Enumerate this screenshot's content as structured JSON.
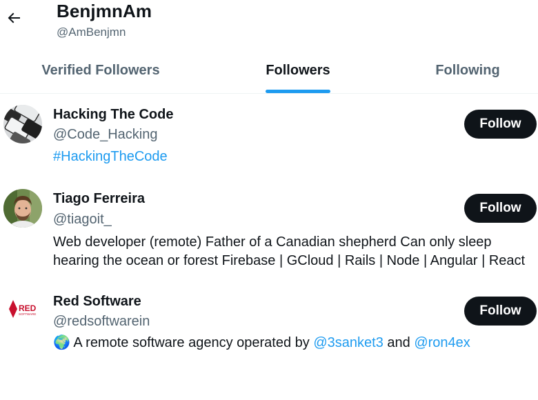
{
  "header": {
    "name": "BenjmnAm",
    "handle": "@AmBenjmn",
    "back_icon": "arrow-left-icon"
  },
  "tabs": [
    {
      "label": "Verified Followers",
      "active": false
    },
    {
      "label": "Followers",
      "active": true
    },
    {
      "label": "Following",
      "active": false
    }
  ],
  "colors": {
    "accent": "#1d9bf0",
    "text_primary": "#0f1419",
    "text_secondary": "#536471",
    "button_bg": "#0f1419"
  },
  "users": [
    {
      "name": "Hacking The Code",
      "handle": "@Code_Hacking",
      "bio": {
        "hashtag": "#HackingTheCode"
      },
      "button": "Follow"
    },
    {
      "name": "Tiago Ferreira",
      "handle": "@tiagoit_",
      "bio": {
        "line1": "Web developer (remote) Father of a Canadian shepherd Can only sleep",
        "line2": "hearing the ocean or forest Firebase | GCloud | Rails | Node | Angular | React"
      },
      "button": "Follow"
    },
    {
      "name": "Red Software",
      "handle": "@redsoftwarein",
      "avatar_text": "RED",
      "avatar_subtext": "SOFTWARE",
      "bio": {
        "emoji": "🌍",
        "text1": "A remote software agency operated by",
        "mention1": "@3sanket3",
        "text2": "and",
        "mention2": "@ron4ex"
      },
      "button": "Follow"
    }
  ]
}
